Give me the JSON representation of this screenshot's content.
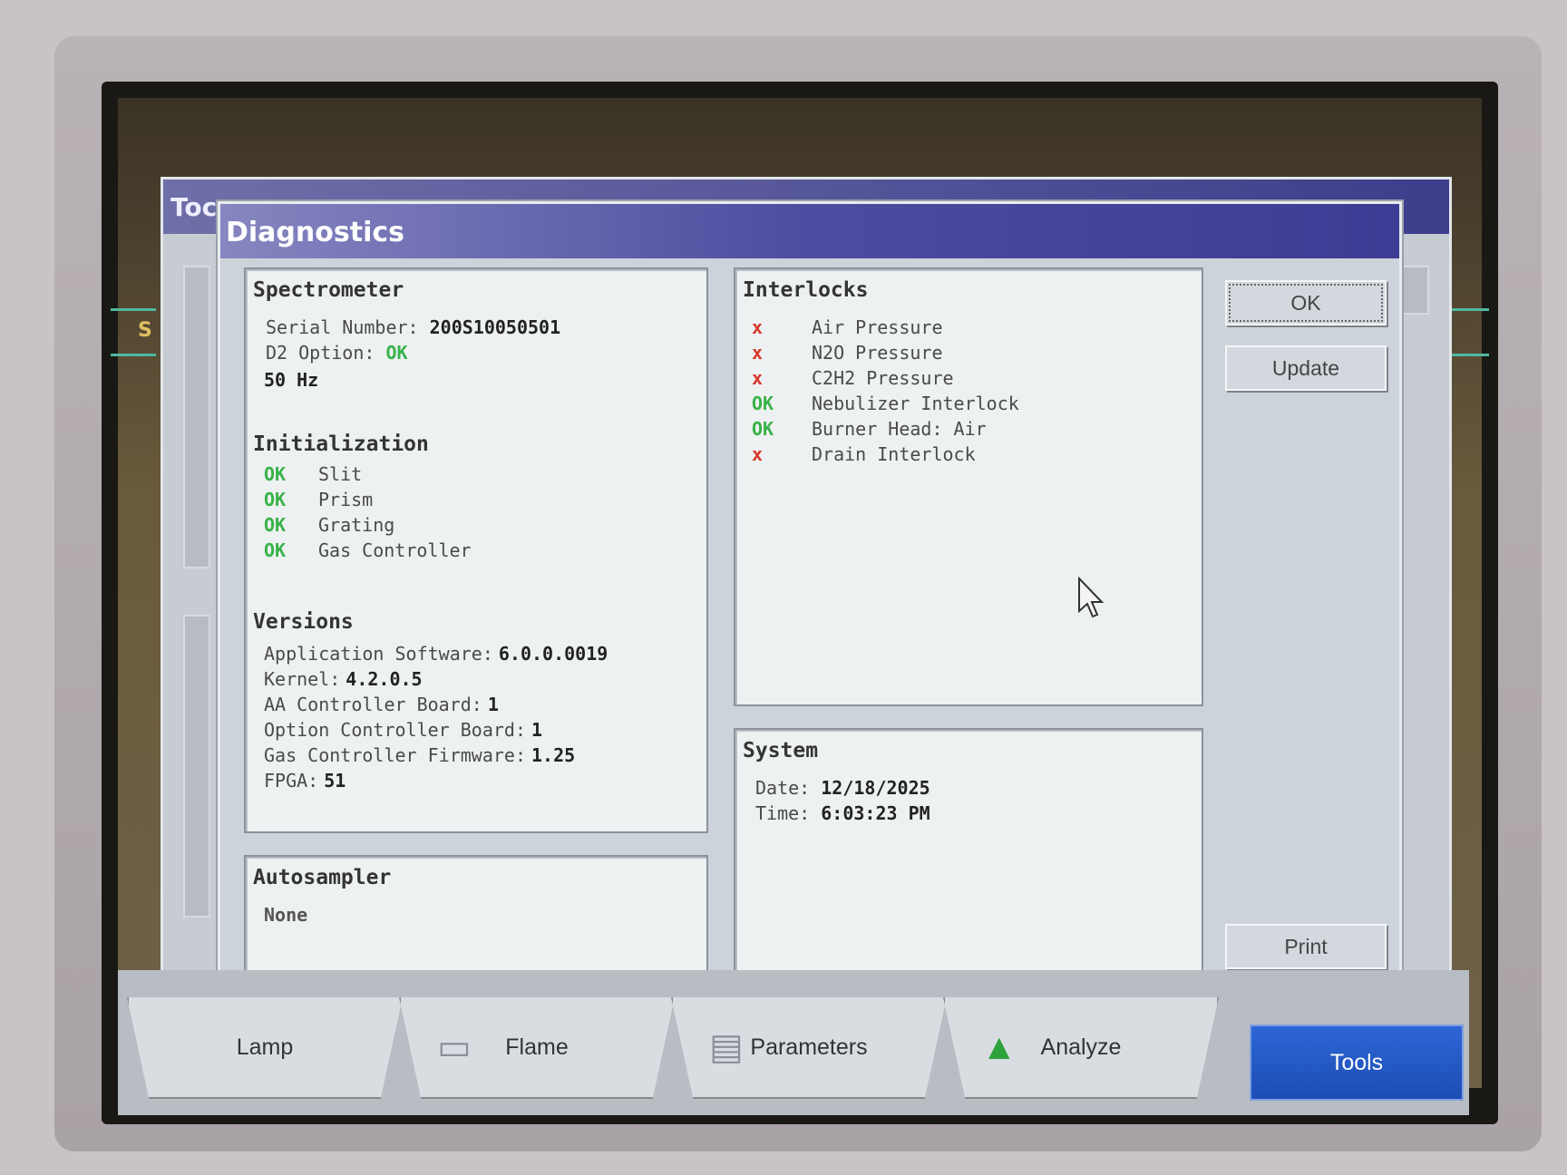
{
  "window": {
    "title_partial": "Toc"
  },
  "dialog": {
    "title": "Diagnostics",
    "spectrometer": {
      "heading": "Spectrometer",
      "serial_label": "Serial Number:",
      "serial_value": "200S10050501",
      "d2_label": "D2 Option:",
      "d2_value": "OK",
      "frequency": "50 Hz"
    },
    "initialization": {
      "heading": "Initialization",
      "items": [
        {
          "status": "OK",
          "label": "Slit"
        },
        {
          "status": "OK",
          "label": "Prism"
        },
        {
          "status": "OK",
          "label": "Grating"
        },
        {
          "status": "OK",
          "label": "Gas Controller"
        }
      ]
    },
    "versions": {
      "heading": "Versions",
      "items": [
        {
          "label": "Application Software:",
          "value": "6.0.0.0019"
        },
        {
          "label": "Kernel:",
          "value": "4.2.0.5"
        },
        {
          "label": "AA Controller Board:",
          "value": "1"
        },
        {
          "label": "Option Controller Board:",
          "value": "1"
        },
        {
          "label": "Gas Controller Firmware:",
          "value": "1.25"
        },
        {
          "label": "FPGA:",
          "value": "51"
        }
      ]
    },
    "autosampler": {
      "heading": "Autosampler",
      "value": "None"
    },
    "interlocks": {
      "heading": "Interlocks",
      "items": [
        {
          "status": "x",
          "label": "Air Pressure"
        },
        {
          "status": "x",
          "label": "N2O Pressure"
        },
        {
          "status": "x",
          "label": "C2H2 Pressure"
        },
        {
          "status": "OK",
          "label": "Nebulizer Interlock"
        },
        {
          "status": "OK",
          "label": "Burner Head: Air"
        },
        {
          "status": "x",
          "label": "Drain Interlock"
        }
      ]
    },
    "system": {
      "heading": "System",
      "date_label": "Date:",
      "date_value": "12/18/2025",
      "time_label": "Time:",
      "time_value": "6:03:23 PM"
    },
    "buttons": {
      "ok": "OK",
      "update": "Update",
      "print": "Print"
    }
  },
  "tabs": [
    {
      "label": "Lamp"
    },
    {
      "label": "Flame"
    },
    {
      "label": "Parameters"
    },
    {
      "label": "Analyze"
    },
    {
      "label": "Tools"
    }
  ],
  "side_label": "S",
  "colors": {
    "ok": "#38b24a",
    "fail": "#d8362a",
    "active_tab": "#2e66d6",
    "title_bar": "#4c4ca0"
  }
}
